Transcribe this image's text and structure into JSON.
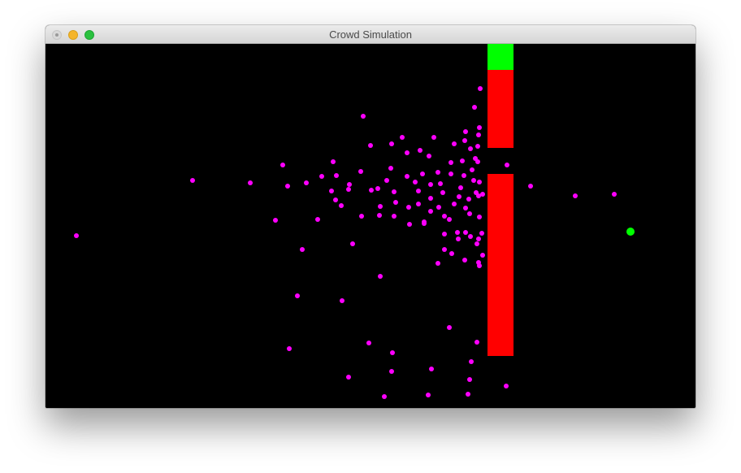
{
  "window": {
    "title": "Crowd Simulation",
    "buttons": [
      {
        "name": "close",
        "color": "#d9d9d9"
      },
      {
        "name": "minimize",
        "color": "#f5b52a"
      },
      {
        "name": "zoom",
        "color": "#2ac13f"
      }
    ]
  },
  "scene": {
    "background": "#000000",
    "agent_color": "#ff00ff",
    "goal_color": "#00ff00",
    "wall_color": "#ff0000",
    "exit_color": "#00ff00"
  }
}
